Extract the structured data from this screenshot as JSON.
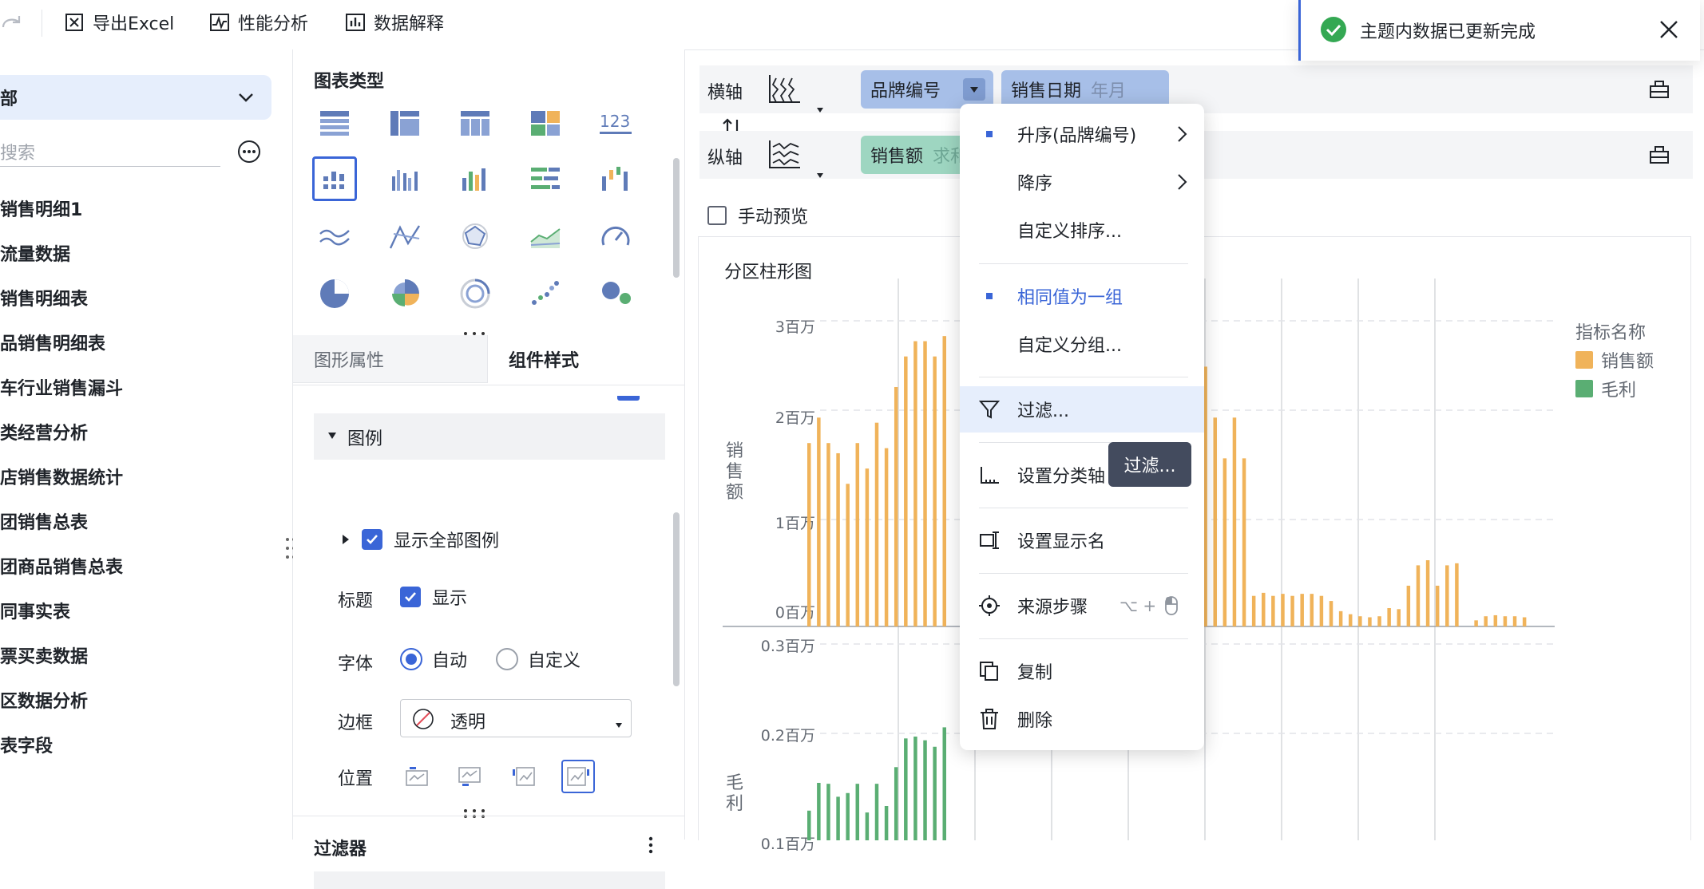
{
  "toolbar": {
    "export_excel": "导出Excel",
    "perf_analysis": "性能分析",
    "data_explain": "数据解释"
  },
  "sidebar": {
    "selected_group": "部",
    "search_placeholder": "搜索",
    "items": [
      {
        "label": "销售明细1"
      },
      {
        "label": "流量数据"
      },
      {
        "label": "销售明细表"
      },
      {
        "label": "品销售明细表"
      },
      {
        "label": "车行业销售漏斗"
      },
      {
        "label": "类经营分析"
      },
      {
        "label": "店销售数据统计"
      },
      {
        "label": "团销售总表"
      },
      {
        "label": "团商品销售总表"
      },
      {
        "label": "同事实表"
      },
      {
        "label": "票买卖数据"
      },
      {
        "label": "区数据分析"
      },
      {
        "label": "表字段"
      }
    ]
  },
  "panel": {
    "chart_type_title": "图表类型",
    "tabs": {
      "graphic_props": "图形属性",
      "component_style": "组件样式"
    },
    "legend_section": "图例",
    "show_all_legend": "显示全部图例",
    "title_label": "标题",
    "title_show": "显示",
    "font_label": "字体",
    "font_auto": "自动",
    "font_custom": "自定义",
    "border_label": "边框",
    "border_value": "透明",
    "position_label": "位置",
    "filter_title": "过滤器"
  },
  "axes": {
    "x_label": "横轴",
    "y_label": "纵轴",
    "x_field1": "品牌编号",
    "x_field2": "销售日期",
    "x_field2_sub": "年月",
    "y_field1": "销售额",
    "y_field1_sub": "求和",
    "manual_preview": "手动预览"
  },
  "context_menu": {
    "items": [
      {
        "label": "升序(品牌编号)"
      },
      {
        "label": "降序"
      },
      {
        "label": "自定义排序..."
      },
      {
        "label": "相同值为一组"
      },
      {
        "label": "自定义分组..."
      },
      {
        "label": "过滤..."
      },
      {
        "label": "设置分类轴"
      },
      {
        "label": "设置显示名"
      },
      {
        "label": "来源步骤"
      },
      {
        "label": "复制"
      },
      {
        "label": "删除"
      }
    ],
    "source_shortcut": "⌥ +"
  },
  "tooltip": "过滤...",
  "toast": {
    "message": "主题内数据已更新完成"
  },
  "colors": {
    "accent": "#3a65d7",
    "sales": "#f0b35a",
    "profit": "#5aae73"
  },
  "chart_data": {
    "type": "bar",
    "title": "分区柱形图",
    "legend_title": "指标名称",
    "series": [
      {
        "name": "销售额",
        "ylabel": "销售额",
        "ticks": [
          "0百万",
          "1百万",
          "2百万",
          "3百万"
        ],
        "ylim": [
          0,
          3000000
        ],
        "values": [
          1800000,
          2050000,
          1800000,
          1700000,
          1400000,
          1800000,
          1550000,
          2000000,
          1750000,
          2350000,
          2650000,
          2800000,
          2800000,
          2650000,
          2850000,
          0,
          0,
          0,
          0,
          0,
          0,
          0,
          0,
          0,
          0,
          0,
          0,
          0,
          0,
          0,
          0,
          0,
          0,
          0,
          0,
          0,
          0,
          0,
          1050000,
          1550000,
          2250000,
          2550000,
          2050000,
          1650000,
          2050000,
          1650000,
          300000,
          330000,
          300000,
          320000,
          300000,
          320000,
          320000,
          300000,
          250000,
          150000,
          120000,
          100000,
          90000,
          100000,
          180000,
          170000,
          400000,
          600000,
          650000,
          400000,
          600000,
          620000,
          0,
          60000,
          100000,
          110000,
          100000,
          100000,
          90000
        ]
      },
      {
        "name": "毛利",
        "ylabel": "毛利",
        "ticks": [
          "0.1百万",
          "0.2百万",
          "0.3百万"
        ],
        "ylim": [
          0.05,
          0.3
        ],
        "values": [
          0.12,
          0.15,
          0.149,
          0.135,
          0.139,
          0.149,
          0.118,
          0.149,
          0.125,
          0.167,
          0.198,
          0.2,
          0.196,
          0.189,
          0.21,
          0,
          0,
          0,
          0,
          0,
          0,
          0,
          0,
          0,
          0,
          0,
          0,
          0,
          0,
          0,
          0,
          0,
          0,
          0,
          0,
          0,
          0,
          0,
          0.062,
          0.068,
          0.07,
          0.065,
          0.06,
          0.058,
          0,
          0,
          0,
          0,
          0,
          0,
          0,
          0,
          0,
          0,
          0,
          0,
          0,
          0,
          0,
          0,
          0,
          0,
          0,
          0,
          0,
          0,
          0,
          0,
          0,
          0,
          0,
          0,
          0,
          0,
          0
        ]
      }
    ]
  }
}
